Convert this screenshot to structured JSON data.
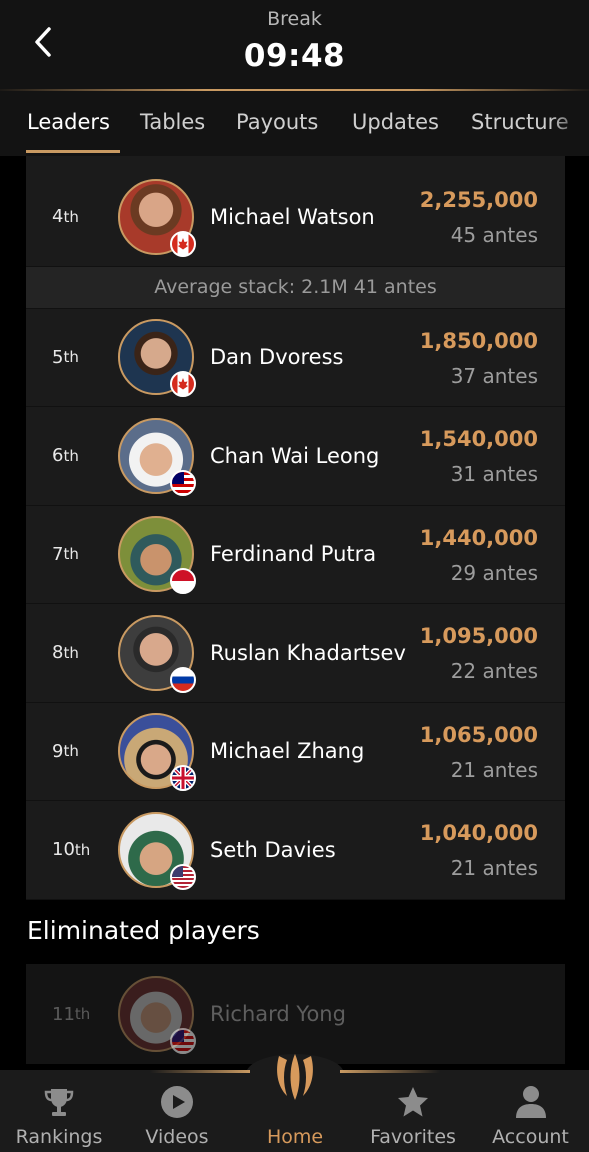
{
  "header": {
    "status": "Break",
    "clock": "09:48"
  },
  "tabs": [
    {
      "label": "Leaders",
      "active": true
    },
    {
      "label": "Tables",
      "active": false
    },
    {
      "label": "Payouts",
      "active": false
    },
    {
      "label": "Updates",
      "active": false
    },
    {
      "label": "Structure",
      "active": false
    }
  ],
  "leaders": [
    {
      "rank": "4",
      "suffix": "th",
      "name": "Michael Watson",
      "stack": "2,255,000",
      "antes": "45 antes",
      "flag": "canada-flag-icon"
    },
    {
      "rank": "5",
      "suffix": "th",
      "name": "Dan Dvoress",
      "stack": "1,850,000",
      "antes": "37 antes",
      "flag": "canada-flag-icon"
    },
    {
      "rank": "6",
      "suffix": "th",
      "name": "Chan Wai Leong",
      "stack": "1,540,000",
      "antes": "31 antes",
      "flag": "malaysia-flag-icon"
    },
    {
      "rank": "7",
      "suffix": "th",
      "name": "Ferdinand Putra",
      "stack": "1,440,000",
      "antes": "29 antes",
      "flag": "indonesia-flag-icon"
    },
    {
      "rank": "8",
      "suffix": "th",
      "name": "Ruslan Khadartsev",
      "stack": "1,095,000",
      "antes": "22 antes",
      "flag": "russia-flag-icon"
    },
    {
      "rank": "9",
      "suffix": "th",
      "name": "Michael Zhang",
      "stack": "1,065,000",
      "antes": "21 antes",
      "flag": "uk-flag-icon"
    },
    {
      "rank": "10",
      "suffix": "th",
      "name": "Seth Davies",
      "stack": "1,040,000",
      "antes": "21 antes",
      "flag": "usa-flag-icon"
    }
  ],
  "average_stack": "Average stack: 2.1M 41 antes",
  "eliminated": {
    "title": "Eliminated players",
    "players": [
      {
        "rank": "11",
        "suffix": "th",
        "name": "Richard Yong",
        "flag": "malaysia-flag-icon"
      }
    ]
  },
  "bottom_nav": [
    {
      "label": "Rankings",
      "icon": "trophy-icon",
      "active": false
    },
    {
      "label": "Videos",
      "icon": "play-icon",
      "active": false
    },
    {
      "label": "Home",
      "icon": "brand-logo-icon",
      "active": true
    },
    {
      "label": "Favorites",
      "icon": "star-icon",
      "active": false
    },
    {
      "label": "Account",
      "icon": "user-icon",
      "active": false
    }
  ],
  "colors": {
    "accent_gold": "#d79a5c",
    "background": "#000000",
    "card": "#1b1b1b"
  }
}
